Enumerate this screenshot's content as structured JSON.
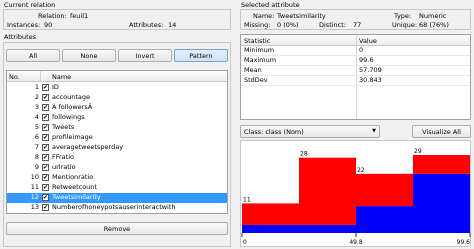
{
  "current_relation": {
    "title": "Current relation",
    "relation_label": "Relation:",
    "relation_value": "feuil1",
    "instances_label": "Instances:",
    "instances_value": "90",
    "attributes_label": "Attributes:",
    "attributes_value": "14"
  },
  "attributes_panel": {
    "title": "Attributes",
    "buttons": {
      "all": "All",
      "none": "None",
      "invert": "Invert",
      "pattern": "Pattern"
    },
    "headers": {
      "no": "No.",
      "name": "Name"
    },
    "rows": [
      {
        "no": "1",
        "name": "ID"
      },
      {
        "no": "2",
        "name": "accountage"
      },
      {
        "no": "3",
        "name": "À followersÂ"
      },
      {
        "no": "4",
        "name": "followings"
      },
      {
        "no": "5",
        "name": "Tweets"
      },
      {
        "no": "6",
        "name": "profileimage"
      },
      {
        "no": "7",
        "name": "averagetweetsperday"
      },
      {
        "no": "8",
        "name": "FFratio"
      },
      {
        "no": "9",
        "name": "urlratio"
      },
      {
        "no": "10",
        "name": "Mentionratio"
      },
      {
        "no": "11",
        "name": "Retweetcount"
      },
      {
        "no": "12",
        "name": "Tweetsimilarity"
      },
      {
        "no": "13",
        "name": "Numberofhoneypotsauserinteractwith"
      }
    ],
    "selected_index": 11,
    "check_glyph": "✔",
    "remove_label": "Remove"
  },
  "selected_attribute": {
    "title": "Selected attribute",
    "name_label": "Name:",
    "name_value": "Tweetsimilarity",
    "type_label": "Type:",
    "type_value": "Numeric",
    "missing_label": "Missing:",
    "missing_value": "0 (0%)",
    "distinct_label": "Distinct:",
    "distinct_value": "77",
    "unique_label": "Unique:",
    "unique_value": "68 (76%)"
  },
  "stats_table": {
    "headers": {
      "statistic": "Statistic",
      "value": "Value"
    },
    "rows": [
      {
        "statistic": "Minimum",
        "value": "0"
      },
      {
        "statistic": "Maximum",
        "value": "99.6"
      },
      {
        "statistic": "Mean",
        "value": "57.709"
      },
      {
        "statistic": "StdDev",
        "value": "30.843"
      }
    ]
  },
  "class_select": {
    "value": "Class: class (Nom)",
    "arrow": "▼"
  },
  "visualize_label": "Visualize All",
  "colors": {
    "red": "#ff0000",
    "blue": "#0000ff",
    "selection": "#3399ff"
  },
  "chart_data": {
    "type": "bar",
    "stacked": true,
    "bins": [
      "0–24.9",
      "24.9–49.8",
      "49.8–74.7",
      "74.7–99.6"
    ],
    "totals": [
      11,
      28,
      22,
      29
    ],
    "series": [
      {
        "color": "#0000ff",
        "values": [
          3,
          3,
          10,
          22
        ]
      },
      {
        "color": "#ff0000",
        "values": [
          8,
          25,
          12,
          7
        ]
      }
    ],
    "x_ticks": [
      "0",
      "49.8",
      "99.6"
    ],
    "ylim": [
      0,
      29
    ]
  }
}
